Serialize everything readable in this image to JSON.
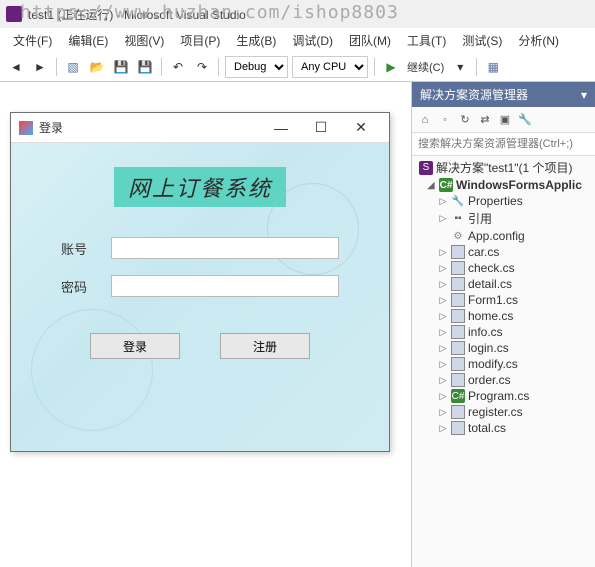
{
  "watermark_url": "https://www.huzhan.com/ishop8803",
  "titlebar": {
    "text": "test1 (正在运行) - Microsoft Visual Studio"
  },
  "menubar": {
    "items": [
      "文件(F)",
      "编辑(E)",
      "视图(V)",
      "项目(P)",
      "生成(B)",
      "调试(D)",
      "团队(M)",
      "工具(T)",
      "测试(S)",
      "分析(N)"
    ]
  },
  "toolbar": {
    "config_dropdown": "Debug",
    "platform_dropdown": "Any CPU",
    "continue_label": "继续(C)"
  },
  "login_form": {
    "window_title": "登录",
    "app_title": "网上订餐系统",
    "account_label": "账号",
    "password_label": "密码",
    "login_btn": "登录",
    "register_btn": "注册"
  },
  "solution": {
    "panel_title": "解决方案资源管理器",
    "search_placeholder": "搜索解决方案资源管理器(Ctrl+;)",
    "root_label": "解决方案\"test1\"(1 个项目)",
    "project_label": "WindowsFormsApplic",
    "nodes": {
      "properties": "Properties",
      "references": "引用",
      "appconfig": "App.config",
      "files": [
        "car.cs",
        "check.cs",
        "detail.cs",
        "Form1.cs",
        "home.cs",
        "info.cs",
        "login.cs",
        "modify.cs",
        "order.cs",
        "Program.cs",
        "register.cs",
        "total.cs"
      ]
    }
  }
}
